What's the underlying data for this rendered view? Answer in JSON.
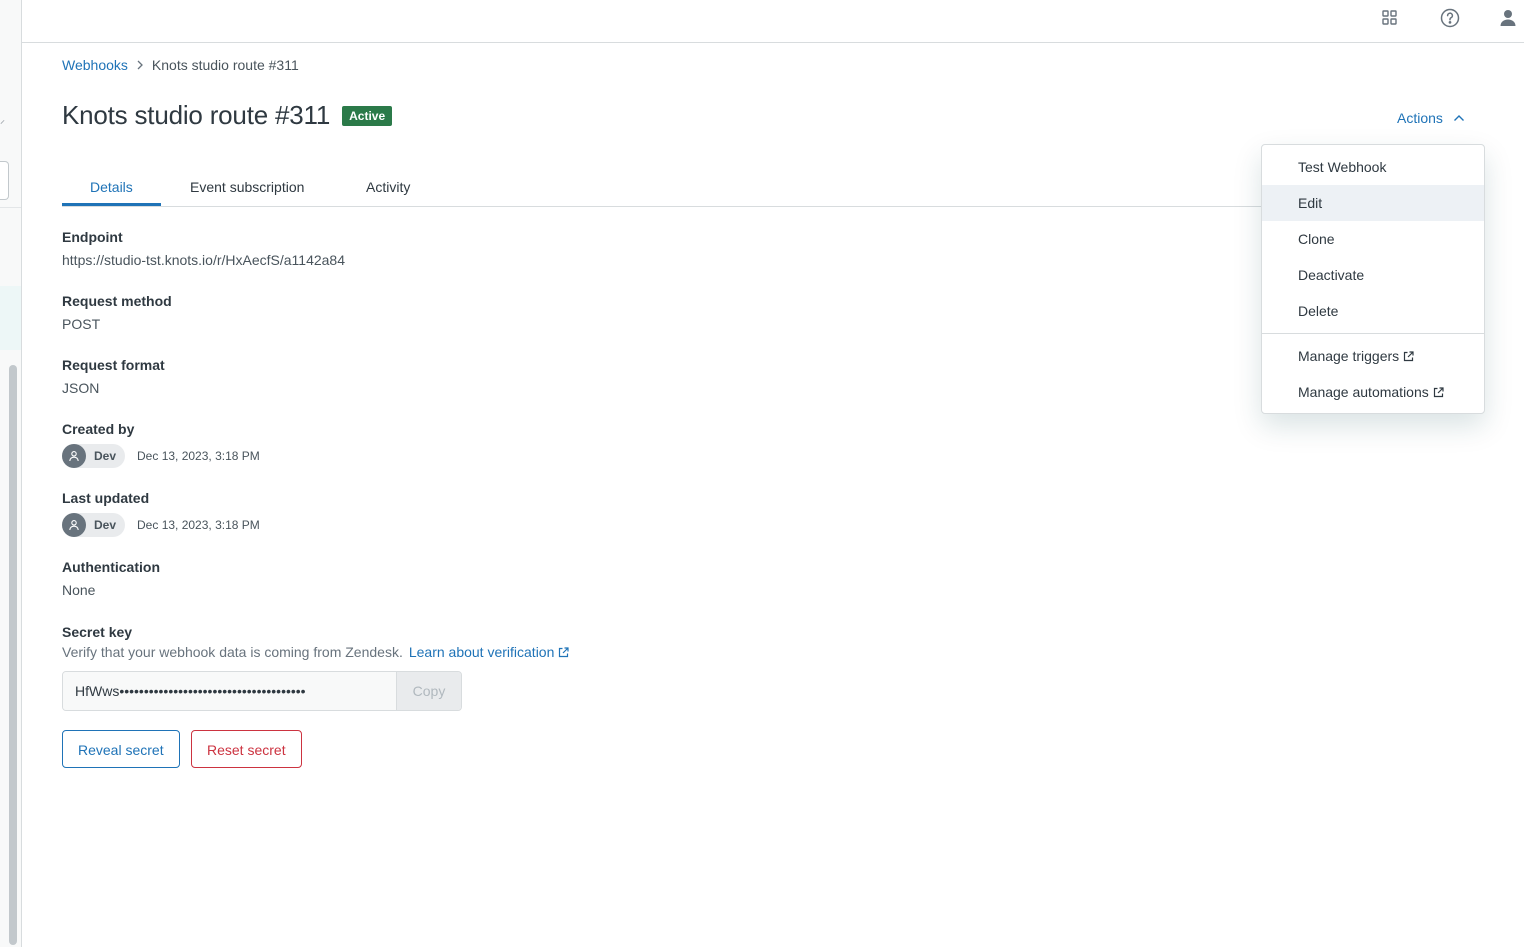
{
  "header": {
    "icons": [
      "apps-icon",
      "help-icon",
      "user-icon"
    ]
  },
  "breadcrumb": {
    "parent": "Webhooks",
    "current": "Knots studio route #311"
  },
  "page": {
    "title": "Knots studio route #311",
    "status": "Active",
    "status_color": "#2b7a49",
    "actions_label": "Actions"
  },
  "tabs": [
    {
      "label": "Details",
      "active": true
    },
    {
      "label": "Event subscription",
      "active": false
    },
    {
      "label": "Activity",
      "active": false
    }
  ],
  "details": {
    "endpoint": {
      "label": "Endpoint",
      "value": "https://studio-tst.knots.io/r/HxAecfS/a1142a84"
    },
    "request_method": {
      "label": "Request method",
      "value": "POST"
    },
    "request_format": {
      "label": "Request format",
      "value": "JSON"
    },
    "created_by": {
      "label": "Created by",
      "user": "Dev",
      "date": "Dec 13, 2023, 3:18 PM"
    },
    "last_updated": {
      "label": "Last updated",
      "user": "Dev",
      "date": "Dec 13, 2023, 3:18 PM"
    },
    "authentication": {
      "label": "Authentication",
      "value": "None"
    },
    "secret_key": {
      "label": "Secret key",
      "hint": "Verify that your webhook data is coming from Zendesk.",
      "link": "Learn about verification",
      "masked_value": "HfWws••••••••••••••••••••••••••••••••••••••",
      "copy_label": "Copy",
      "reveal_label": "Reveal secret",
      "reset_label": "Reset secret"
    }
  },
  "actions_menu": {
    "items": [
      "Test Webhook",
      "Edit",
      "Clone",
      "Deactivate",
      "Delete"
    ],
    "links": [
      "Manage triggers",
      "Manage automations"
    ],
    "hovered": "Edit"
  },
  "colors": {
    "accent": "#1f73b7",
    "danger": "#cc3340",
    "text": "#2f3941"
  }
}
